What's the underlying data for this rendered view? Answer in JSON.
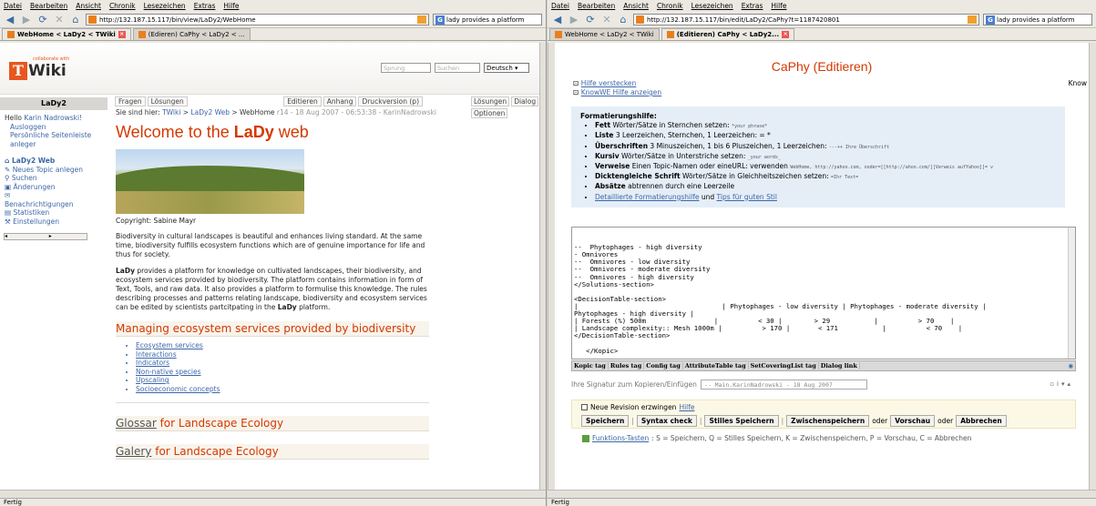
{
  "left": {
    "menu": [
      "Datei",
      "Bearbeiten",
      "Ansicht",
      "Chronik",
      "Lesezeichen",
      "Extras",
      "Hilfe"
    ],
    "url": "http://132.187.15.117/bin/view/LaDy2/WebHome",
    "search": "lady provides a platform",
    "tabs": [
      "WebHome < LaDy2 < TWiki",
      "(Edieren) CaPhy < LaDy2 < ..."
    ],
    "status": "Fertig",
    "page": {
      "logo_collab": "collaborate with",
      "logo_t": "T",
      "logo_wiki": "Wiki",
      "jump_placeholder": "Sprung",
      "search_placeholder": "Suchen",
      "language": "Deutsch",
      "web_name": "LaDy2",
      "hello": "Hello",
      "user": "Karin Nadrowski!",
      "side_links": [
        "Ausloggen",
        "Persönliche Seitenleiste anleger"
      ],
      "nav": [
        "LaDy2 Web",
        "Neues Topic anlegen",
        "Suchen",
        "Änderungen",
        "Benachrichtigungen",
        "Statistiken",
        "Einstellungen"
      ],
      "topbar_left": [
        "Fragen",
        "Lösungen"
      ],
      "topbar_right": [
        "Editieren",
        "Anhang",
        "Druckversion (p)"
      ],
      "rightbar": [
        "Lösungen",
        "Dialog",
        "Optionen"
      ],
      "breadcrumb_prefix": "Sie sind hier:",
      "breadcrumb": [
        "TWiki",
        "LaDy2 Web",
        "WebHome"
      ],
      "revision": "r14 - 18 Aug 2007 - 06:53:38 - KarinNadrowski",
      "title_pre": "Welcome to the ",
      "title_bold": "LaDy",
      "title_post": " web",
      "copyright": "Copyright: Sabine Mayr",
      "para1": "Biodiversity in cultural landscapes is beautiful and enhances living standard. At the same time, biodiversity fulfills ecosystem functions which are of genuine importance for life and thus for society.",
      "para2_a": "LaDy",
      "para2_b": " provides a platform for knowledge on cultivated landscapes, their biodiversity, and ecosystem services provided by biodiversity. The platform contains information in form of Text, Tools, and raw data. It also provides a platform to formulise this knowledge. The rules describing processes and patterns relating landscape, biodiversity and ecosystem services can be edited by scientists partcitpating in the ",
      "para2_c": "LaDy",
      "para2_d": " platform.",
      "h2": "Managing ecosystem services provided by biodiversity",
      "list": [
        "Ecosystem services",
        "Interactions",
        "Indicators",
        "Non-native species",
        "Upscaling",
        "Socioeconomic concepts"
      ],
      "h3a_link": "Glossar",
      "h3a_rest": " for Landscape Ecology",
      "h3b_link": "Galery",
      "h3b_rest": " for Landscape Ecology"
    }
  },
  "right": {
    "menu": [
      "Datei",
      "Bearbeiten",
      "Ansicht",
      "Chronik",
      "Lesezeichen",
      "Extras",
      "Hilfe"
    ],
    "url": "http://132.187.15.117/bin/edit/LaDy2/CaPhy?t=1187420801",
    "search": "lady provides a platform",
    "tabs": [
      "WebHome < LaDy2 < TWiki",
      "(Editieren) CaPhy < LaDy2..."
    ],
    "status": "Fertig",
    "page": {
      "title": "CaPhy (Editieren)",
      "hide_help": "Hilfe verstecken",
      "knowwe_help": "KnowWE Hilfe anzeigen",
      "know": "Know",
      "help_heading": "Formatierungshilfe:",
      "help_items": [
        {
          "b": "Fett",
          "t": " Wörter/Sätze in Sternchen setzen: ",
          "c": "*your phrase*"
        },
        {
          "b": "Liste",
          "t": " 3 Leerzeichen, Sternchen, 1 Leerzeichen: =  *",
          "c": ""
        },
        {
          "b": "Überschriften",
          "t": " 3 Minuszeichen, 1 bis 6 Pluszeichen, 1 Leerzeichen: ",
          "c": "---++ Ihre Überschrift"
        },
        {
          "b": "Kursiv",
          "t": " Wörter/Sätze in Unterstriche setzen: ",
          "c": "_your words_"
        },
        {
          "b": "Verweise",
          "t": " Einen Topic-Namen oder eineURL: verwenden ",
          "c": "WebHome, http://yahoo.com, ooder=[[http://ahoo.com/][Verweis aufYahoo]]= v"
        },
        {
          "b": "Dicktengleiche Schrift",
          "t": " Wörter/Sätze in Gleichheitszeichen setzen: ",
          "c": "=Ihr Text="
        },
        {
          "b": "Absätze",
          "t": " abtrennen durch eine Leerzeile",
          "c": ""
        }
      ],
      "help_link1": "Detaillierte Formatierungshilfe",
      "help_and": " und ",
      "help_link2": "Tips für guten Stil",
      "editor_lines": [
        "--  Phytophages - high diversity",
        "- Omnivores",
        "--  Omnivores - low diversity",
        "--  Omnivores - moderate diversity",
        "--  Omnivores - high diversity",
        "</Solutions-section>",
        "",
        "<DecisionTable-section>",
        "|                                    | Phytophages - low diversity | Phytophages - moderate diversity |",
        "Phytophages - high diversity |",
        "| Forests (%) 500m                 |          < 30 |        > 29           |          > 70    |",
        "| Landscape complexity:: Mesh 1000m |          > 170 |       < 171           |          < 70    |",
        "</DecisionTable-section>",
        "",
        "   </Kopic>"
      ],
      "tags": [
        "Kopic tag",
        "Rules tag",
        "Config tag",
        "AttributeTable tag",
        "SetCoveringList tag",
        "Dialog link"
      ],
      "sig_label": "Ihre Signatur zum Kopieren/Einfügen",
      "sig_value": "-- Main.KarinNadrowski - 18 Aug 2007",
      "force_rev": "Neue Revision erzwingen",
      "help": "Hilfe",
      "buttons": [
        "Speichern",
        "Syntax check",
        "Stilles Speichern",
        "Zwischenspeichern",
        "Vorschau",
        "Abbrechen"
      ],
      "oder": "oder",
      "keys_link": "Funktions-Tasten",
      "keys_text": ": S = Speichern, Q = Stilles Speichern, K = Zwischenspeichern, P = Vorschau, C = Abbrechen"
    }
  },
  "colors": {
    "accent": "#d53800",
    "link": "#3c66a8",
    "helpbg": "#e5eef7"
  }
}
